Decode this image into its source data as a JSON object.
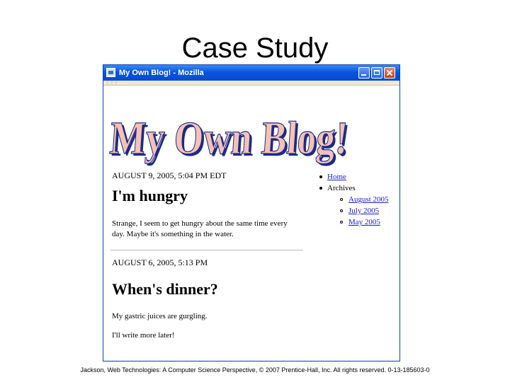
{
  "slide": {
    "title": "Case Study",
    "footer": "Jackson, Web Technologies: A Computer Science Perspective, © 2007 Prentice-Hall, Inc. All rights reserved. 0-13-185603-0"
  },
  "window": {
    "title": "My Own Blog! - Mozilla",
    "titlebar_color": "#0a54e0"
  },
  "blog": {
    "logo_text": "My Own Blog!",
    "logo_fill": "#f4c2b4",
    "logo_shadow": "#1c2a8a",
    "posts": [
      {
        "date": "AUGUST 9, 2005, 5:04 PM EDT",
        "title": "I'm hungry",
        "paragraphs": [
          "Strange, I seem to get hungry about the same time every",
          "day. Maybe it's something in the water."
        ]
      },
      {
        "date": "AUGUST 6, 2005, 5:13 PM",
        "title": "When's dinner?",
        "paragraphs": [
          "My gastric juices are gurgling.",
          "I'll write more later!"
        ]
      }
    ],
    "sidebar": {
      "items": [
        {
          "label": "Home",
          "is_link": true
        },
        {
          "label": "Archives",
          "is_link": false
        }
      ],
      "archives": [
        "August 2005",
        "July 2005",
        "May 2005"
      ]
    }
  }
}
